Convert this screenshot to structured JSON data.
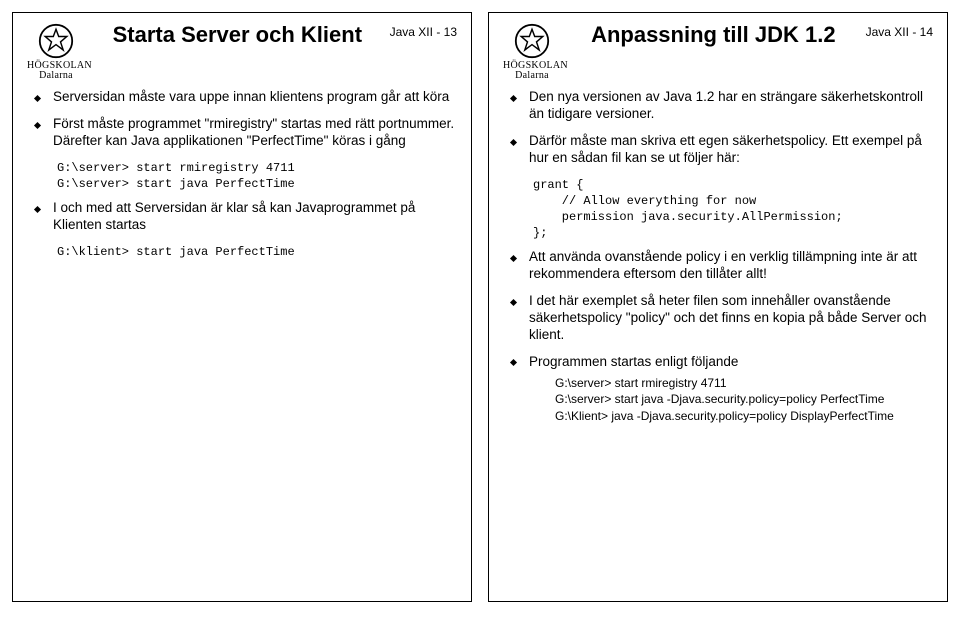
{
  "institution_line1": "HÖGSKOLAN",
  "institution_line2": "Dalarna",
  "left": {
    "pagelabel": "Java XII - 13",
    "title": "Starta Server och Klient",
    "b1": "Serversidan måste vara uppe innan klientens program går att köra",
    "b2": "Först måste programmet \"rmiregistry\" startas med rätt portnummer. Därefter kan Java applikationen \"PerfectTime\" köras i gång",
    "code1": "G:\\server> start rmiregistry 4711\nG:\\server> start java PerfectTime",
    "b3": "I och med att Serversidan är klar så kan Javaprogrammet på Klienten startas",
    "code2": "G:\\klient> start java PerfectTime"
  },
  "right": {
    "pagelabel": "Java XII - 14",
    "title": "Anpassning till JDK 1.2",
    "b1": "Den nya versionen av Java 1.2 har en strängare säkerhetskontroll än tidigare versioner.",
    "b2": "Därför måste man skriva ett egen säkerhetspolicy. Ett exempel på hur en sådan fil kan se ut följer här:",
    "code1": "grant {\n    // Allow everything for now\n    permission java.security.AllPermission;\n};",
    "b3": "Att använda ovanstående policy i en verklig tillämpning inte är att rekommendera eftersom den tillåter allt!",
    "b4": "I det här exemplet så heter filen som innehåller ovanstående säkerhetspolicy \"policy\" och det finns en kopia på både Server och klient.",
    "b5": "Programmen startas enligt följande",
    "sub1": "G:\\server> start rmiregistry 4711",
    "sub2": "G:\\server> start java -Djava.security.policy=policy PerfectTime",
    "sub3": "G:\\Klient> java -Djava.security.policy=policy DisplayPerfectTime"
  }
}
